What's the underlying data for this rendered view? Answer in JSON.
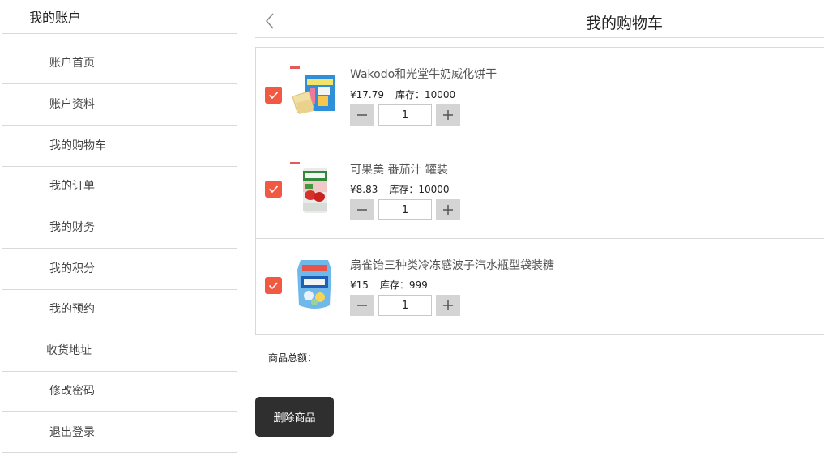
{
  "sidebar": {
    "title": "我的账户",
    "items": [
      {
        "label": "账户首页"
      },
      {
        "label": "账户资料"
      },
      {
        "label": "我的购物车"
      },
      {
        "label": "我的订单"
      },
      {
        "label": "我的财务"
      },
      {
        "label": "我的积分"
      },
      {
        "label": "我的预约"
      },
      {
        "label": "收货地址"
      },
      {
        "label": "修改密码"
      },
      {
        "label": "退出登录"
      }
    ]
  },
  "header": {
    "title": "我的购物车",
    "back_icon": "chevron-left-icon"
  },
  "cart": {
    "items": [
      {
        "name": "Wakodo和光堂牛奶威化饼干",
        "price": "¥17.79",
        "stock": "库存：10000",
        "quantity": "1",
        "checked": true
      },
      {
        "name": "可果美 番茄汁 罐装",
        "price": "¥8.83",
        "stock": "库存：10000",
        "quantity": "1",
        "checked": true
      },
      {
        "name": "扇雀饴三种类冷冻感波子汽水瓶型袋装糖",
        "price": "¥15",
        "stock": "库存：999",
        "quantity": "1",
        "checked": true
      }
    ]
  },
  "footer": {
    "total_label": "商品总额：",
    "delete_label": "删除商品"
  },
  "colors": {
    "checkbox": "#f05a43",
    "delete_button": "#2f2f2f",
    "stepper": "#d4d4d4"
  }
}
